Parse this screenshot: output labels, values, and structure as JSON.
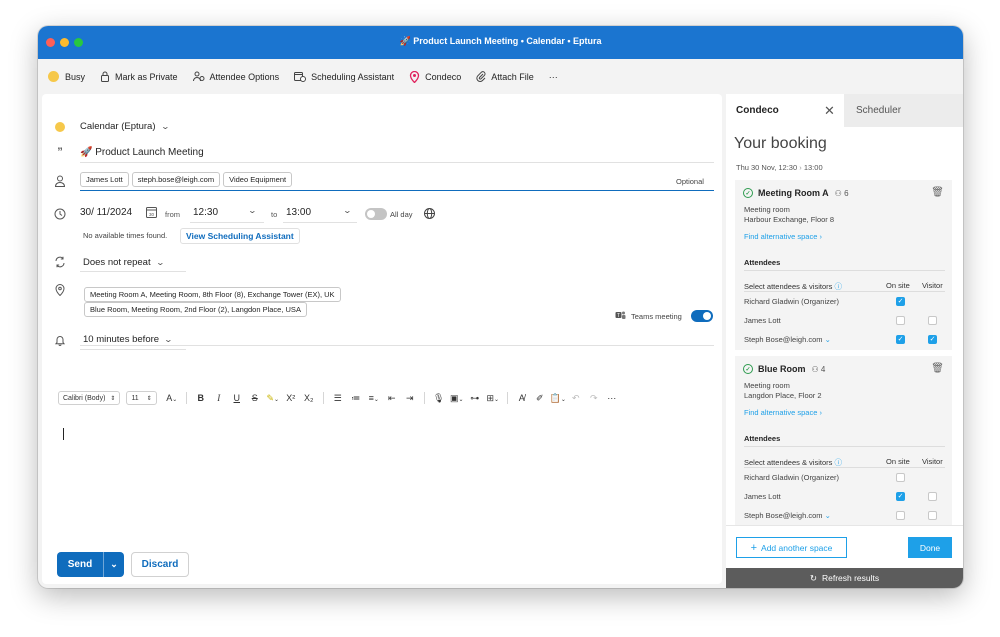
{
  "window": {
    "title": "🚀 Product Launch Meeting • Calendar • Eptura"
  },
  "toolbar": {
    "busy": "Busy",
    "private": "Mark as Private",
    "attendee_options": "Attendee Options",
    "scheduling_assistant": "Scheduling Assistant",
    "condeco": "Condeco",
    "attach_file": "Attach File",
    "more": "···"
  },
  "compose": {
    "calendar": "Calendar (Eptura)",
    "subject": "🚀 Product Launch Meeting",
    "attendees": [
      "James Lott",
      "steph.bose@leigh.com",
      "Video Equipment"
    ],
    "optional_label": "Optional",
    "date": "30/ 11/2024",
    "from_label": "from",
    "start_time": "12:30",
    "to_label": "to",
    "end_time": "13:00",
    "all_day": "All day",
    "no_times": "No available times found.",
    "view_assistant": "View Scheduling Assistant",
    "repeat": "Does not repeat",
    "locations": [
      "Meeting Room A, Meeting Room, 8th Floor (8), Exchange Tower (EX), UK",
      "Blue Room, Meeting Room, 2nd Floor (2), Langdon Place, USA"
    ],
    "teams_meeting": "Teams meeting",
    "reminder": "10 minutes before",
    "font_name": "Calibri (Body)",
    "font_size": "11",
    "send": "Send",
    "discard": "Discard"
  },
  "panel": {
    "tab_condeco": "Condeco",
    "tab_scheduler": "Scheduler",
    "booking_title": "Your booking",
    "booking_date": "Thu 30 Nov, 12:30",
    "booking_end": "13:00",
    "find_alt": "Find alternative space",
    "attendees_title": "Attendees",
    "select_attendees": "Select attendees & visitors",
    "on_site": "On site",
    "visitor": "Visitor",
    "rooms": [
      {
        "name": "Meeting Room A",
        "capacity": "6",
        "type": "Meeting room",
        "location": "Harbour Exchange, Floor 8",
        "attendees": [
          {
            "name": "Richard Gladwin (Organizer)",
            "on_site": true,
            "visitor": null
          },
          {
            "name": "James Lott",
            "on_site": false,
            "visitor": false
          },
          {
            "name": "Steph Bose@leigh.com",
            "on_site": true,
            "visitor": true
          }
        ]
      },
      {
        "name": "Blue Room",
        "capacity": "4",
        "type": "Meeting room",
        "location": "Langdon Place, Floor 2",
        "attendees": [
          {
            "name": "Richard Gladwin (Organizer)",
            "on_site": false,
            "visitor": null
          },
          {
            "name": "James Lott",
            "on_site": true,
            "visitor": false
          },
          {
            "name": "Steph Bose@leigh.com",
            "on_site": false,
            "visitor": false
          }
        ]
      }
    ],
    "add_space": "Add another space",
    "done": "Done",
    "refresh": "Refresh results"
  },
  "colors": {
    "titlebar": "#1b75d0",
    "primary": "#0f6cbd",
    "condeco_accent": "#1ea0e8",
    "busy": "#f6c84a"
  }
}
